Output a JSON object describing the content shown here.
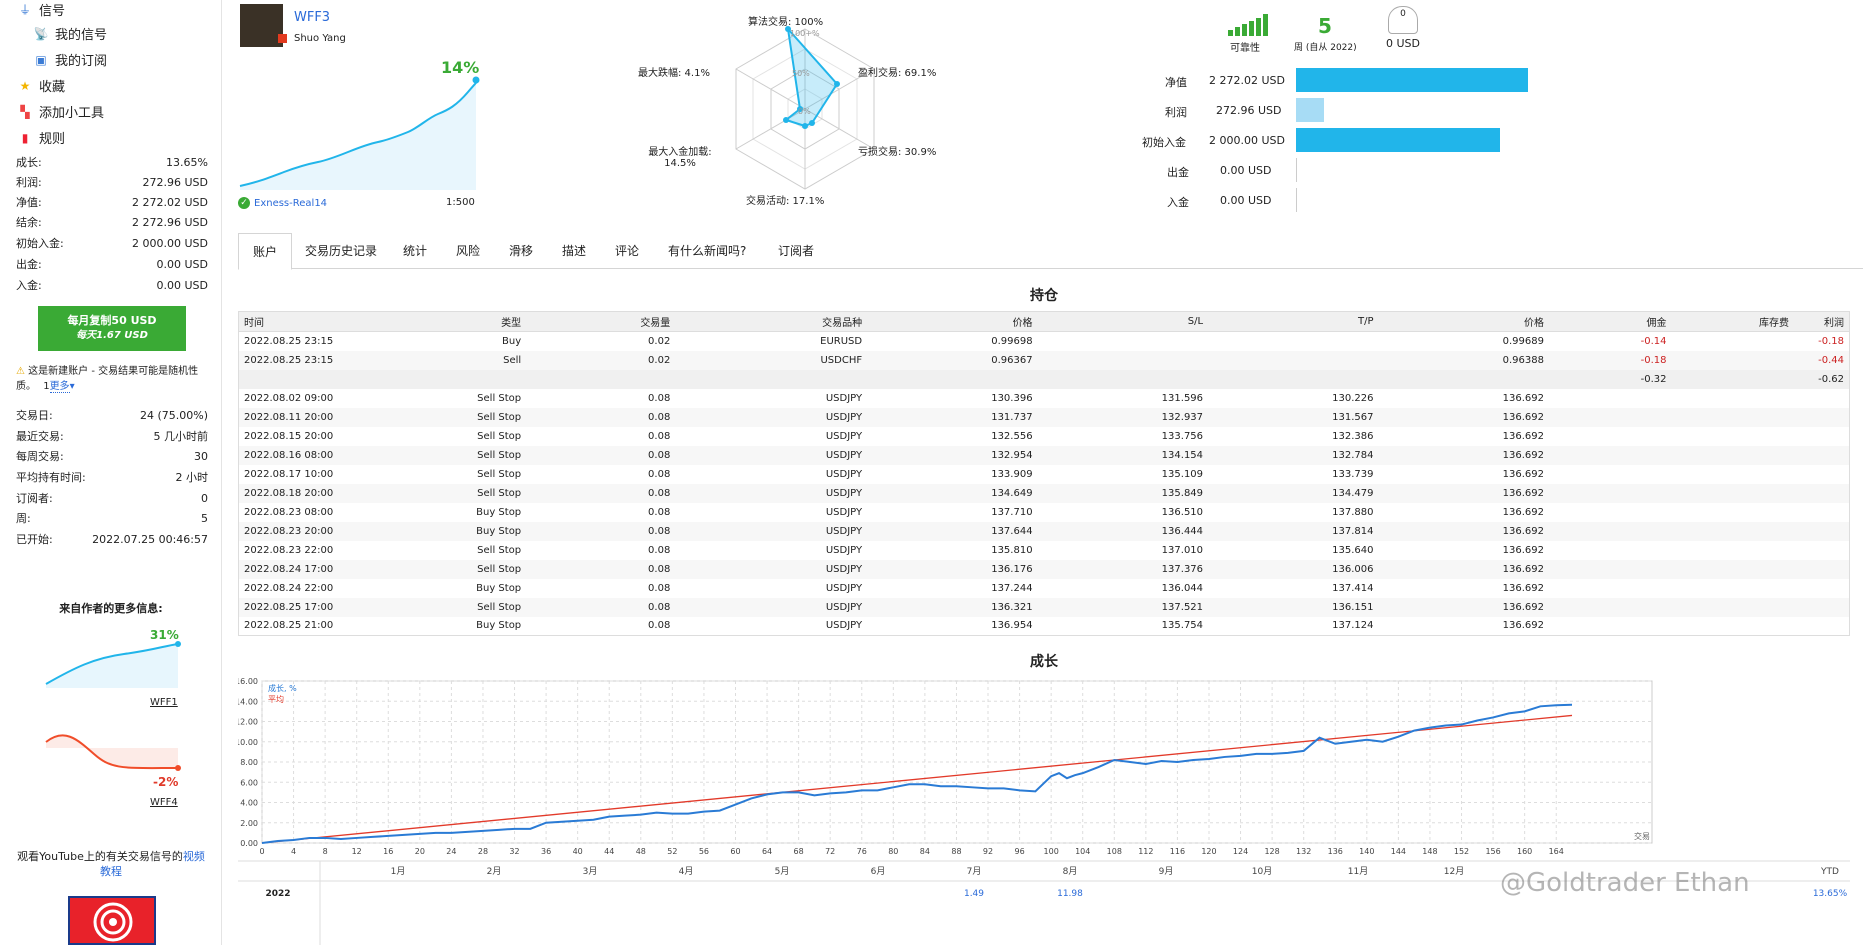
{
  "sidebar": {
    "nav": [
      "信号",
      "我的信号",
      "我的订阅",
      "收藏",
      "添加小工具",
      "规则"
    ],
    "stats": [
      {
        "label": "成长:",
        "value": "13.65%"
      },
      {
        "label": "利润:",
        "value": "272.96 USD"
      },
      {
        "label": "净值:",
        "value": "2 272.02 USD"
      },
      {
        "label": "结余:",
        "value": "2 272.96 USD"
      },
      {
        "label": "初始入金:",
        "value": "2 000.00 USD"
      },
      {
        "label": "出金:",
        "value": "0.00 USD"
      },
      {
        "label": "入金:",
        "value": "0.00 USD"
      }
    ],
    "copy_button": {
      "label": "每月复制50 USD",
      "sub": "每天1.67 USD"
    },
    "warning": "这是新建账户 - 交易结果可能是随机性质。",
    "more_link": "更多",
    "stats2": [
      {
        "label": "交易日:",
        "value": "24 (75.00%)"
      },
      {
        "label": "最近交易:",
        "value": "5 几小时前"
      },
      {
        "label": "每周交易:",
        "value": "30"
      },
      {
        "label": "平均持有时间:",
        "value": "2 小时"
      },
      {
        "label": "订阅者:",
        "value": "0"
      },
      {
        "label": "周:",
        "value": "5"
      },
      {
        "label": "已开始:",
        "value": "2022.07.25 00:46:57"
      }
    ],
    "more_from_author": "来自作者的更多信息:",
    "mini1": {
      "value": "31%",
      "name": "WFF1"
    },
    "mini2": {
      "value": "-2%",
      "name": "WFF4"
    },
    "youtube_text": "观看YouTube上的有关交易信号的",
    "youtube_link": "视频教程"
  },
  "header": {
    "signal_name": "WFF3",
    "author": "Shuo Yang",
    "growth_pct": "14%",
    "broker": "Exness-Real14",
    "leverage": "1:500",
    "radar": {
      "algo": "算法交易: 100%",
      "profit_trades": "盈利交易: 69.1%",
      "loss_trades": "亏损交易: 30.9%",
      "activity": "交易活动: 17.1%",
      "max_deposit_load": "最大入金加载:",
      "max_deposit_load_val": "14.5%",
      "max_drawdown": "最大跌幅: 4.1%",
      "ticks": [
        "100+%",
        "50%",
        "0%"
      ]
    },
    "reliability": "可靠性",
    "weeks": "5",
    "weeks_label": "周 (自从 2022)",
    "subscribers_value": "0",
    "subscribers_usd": "0 USD",
    "finance": [
      {
        "label": "净值",
        "value": "2 272.02 USD",
        "fraction": 1.0
      },
      {
        "label": "利润",
        "value": "272.96 USD",
        "fraction": 0.12
      },
      {
        "label": "初始入金",
        "value": "2 000.00 USD",
        "fraction": 0.88
      },
      {
        "label": "出金",
        "value": "0.00 USD",
        "fraction": 0
      },
      {
        "label": "入金",
        "value": "0.00 USD",
        "fraction": 0
      }
    ]
  },
  "tabs": [
    "账户",
    "交易历史记录",
    "统计",
    "风险",
    "滑移",
    "描述",
    "评论",
    "有什么新闻吗?",
    "订阅者"
  ],
  "positions": {
    "title": "持仓",
    "headers": [
      "时间",
      "类型",
      "交易量",
      "交易品种",
      "价格",
      "S/L",
      "T/P",
      "价格",
      "佣金",
      "库存费",
      "利润"
    ],
    "open": [
      [
        "2022.08.25 23:15",
        "Buy",
        "0.02",
        "EURUSD",
        "0.99698",
        "",
        "",
        "0.99689",
        "-0.14",
        "",
        "-0.18"
      ],
      [
        "2022.08.25 23:15",
        "Sell",
        "0.02",
        "USDCHF",
        "0.96367",
        "",
        "",
        "0.96388",
        "-0.18",
        "",
        "-0.44"
      ]
    ],
    "sum": [
      "",
      "",
      "",
      "",
      "",
      "",
      "",
      "",
      "-0.32",
      "",
      "-0.62"
    ],
    "pending": [
      [
        "2022.08.02 09:00",
        "Sell Stop",
        "0.08",
        "USDJPY",
        "130.396",
        "131.596",
        "130.226",
        "136.692"
      ],
      [
        "2022.08.11 20:00",
        "Sell Stop",
        "0.08",
        "USDJPY",
        "131.737",
        "132.937",
        "131.567",
        "136.692"
      ],
      [
        "2022.08.15 20:00",
        "Sell Stop",
        "0.08",
        "USDJPY",
        "132.556",
        "133.756",
        "132.386",
        "136.692"
      ],
      [
        "2022.08.16 08:00",
        "Sell Stop",
        "0.08",
        "USDJPY",
        "132.954",
        "134.154",
        "132.784",
        "136.692"
      ],
      [
        "2022.08.17 10:00",
        "Sell Stop",
        "0.08",
        "USDJPY",
        "133.909",
        "135.109",
        "133.739",
        "136.692"
      ],
      [
        "2022.08.18 20:00",
        "Sell Stop",
        "0.08",
        "USDJPY",
        "134.649",
        "135.849",
        "134.479",
        "136.692"
      ],
      [
        "2022.08.23 08:00",
        "Buy Stop",
        "0.08",
        "USDJPY",
        "137.710",
        "136.510",
        "137.880",
        "136.692"
      ],
      [
        "2022.08.23 20:00",
        "Buy Stop",
        "0.08",
        "USDJPY",
        "137.644",
        "136.444",
        "137.814",
        "136.692"
      ],
      [
        "2022.08.23 22:00",
        "Sell Stop",
        "0.08",
        "USDJPY",
        "135.810",
        "137.010",
        "135.640",
        "136.692"
      ],
      [
        "2022.08.24 17:00",
        "Sell Stop",
        "0.08",
        "USDJPY",
        "136.176",
        "137.376",
        "136.006",
        "136.692"
      ],
      [
        "2022.08.24 22:00",
        "Buy Stop",
        "0.08",
        "USDJPY",
        "137.244",
        "136.044",
        "137.414",
        "136.692"
      ],
      [
        "2022.08.25 17:00",
        "Sell Stop",
        "0.08",
        "USDJPY",
        "136.321",
        "137.521",
        "136.151",
        "136.692"
      ],
      [
        "2022.08.25 21:00",
        "Buy Stop",
        "0.08",
        "USDJPY",
        "136.954",
        "135.754",
        "137.124",
        "136.692"
      ]
    ]
  },
  "chart_data": {
    "type": "line",
    "title": "成长",
    "legend": [
      "成长, %",
      "平均"
    ],
    "xlabel": "交易",
    "yticks": [
      "0.00",
      "2.00",
      "4.00",
      "6.00",
      "8.00",
      "10.00",
      "12.00",
      "14.00",
      "16.00"
    ],
    "xticks": [
      0,
      4,
      8,
      12,
      16,
      20,
      24,
      28,
      32,
      36,
      40,
      44,
      48,
      52,
      56,
      60,
      64,
      68,
      72,
      76,
      80,
      84,
      88,
      92,
      96,
      100,
      104,
      108,
      112,
      116,
      120,
      124,
      128,
      132,
      136,
      140,
      144,
      148,
      152,
      156,
      160,
      164
    ],
    "ylim": [
      0,
      16
    ],
    "xlim": [
      0,
      166
    ],
    "series": [
      {
        "name": "成长, %",
        "x": [
          0,
          2,
          4,
          6,
          8,
          10,
          12,
          14,
          16,
          18,
          20,
          22,
          24,
          26,
          28,
          30,
          32,
          34,
          36,
          38,
          40,
          42,
          44,
          46,
          48,
          50,
          52,
          54,
          56,
          58,
          60,
          62,
          64,
          66,
          68,
          70,
          72,
          74,
          76,
          78,
          80,
          82,
          84,
          86,
          88,
          90,
          92,
          94,
          96,
          98,
          100,
          101,
          102,
          103,
          104,
          106,
          108,
          110,
          112,
          114,
          116,
          118,
          120,
          122,
          124,
          126,
          128,
          130,
          132,
          134,
          136,
          138,
          140,
          142,
          144,
          146,
          148,
          150,
          152,
          154,
          156,
          158,
          160,
          162,
          164,
          166
        ],
        "y": [
          0,
          0.2,
          0.3,
          0.5,
          0.5,
          0.4,
          0.5,
          0.6,
          0.7,
          0.8,
          0.9,
          1.0,
          1.0,
          1.1,
          1.2,
          1.3,
          1.4,
          1.4,
          2.0,
          2.1,
          2.2,
          2.3,
          2.6,
          2.7,
          2.8,
          3.0,
          2.9,
          2.9,
          3.1,
          3.2,
          3.8,
          4.4,
          4.8,
          5.0,
          5.0,
          4.7,
          4.9,
          5.0,
          5.2,
          5.2,
          5.5,
          5.8,
          5.8,
          5.6,
          5.6,
          5.5,
          5.4,
          5.4,
          5.2,
          5.1,
          6.6,
          6.9,
          6.4,
          6.7,
          6.9,
          7.5,
          8.2,
          8.0,
          7.8,
          8.1,
          8.0,
          8.2,
          8.3,
          8.5,
          8.6,
          8.8,
          8.8,
          8.9,
          9.1,
          10.4,
          9.8,
          10.0,
          10.2,
          10.0,
          10.5,
          11.1,
          11.4,
          11.6,
          11.7,
          12.1,
          12.4,
          12.8,
          13.0,
          13.5,
          13.6,
          13.65
        ]
      },
      {
        "name": "平均",
        "x": [
          0,
          166
        ],
        "y": [
          0,
          12.6
        ]
      }
    ],
    "months": [
      "1月",
      "2月",
      "3月",
      "4月",
      "5月",
      "6月",
      "7月",
      "8月",
      "9月",
      "10月",
      "11月",
      "12月",
      "YTD"
    ],
    "year_row": {
      "year": "2022",
      "jul": "1.49",
      "aug": "11.98",
      "ytd": "13.65%"
    }
  },
  "watermark": "@Goldtrader Ethan"
}
